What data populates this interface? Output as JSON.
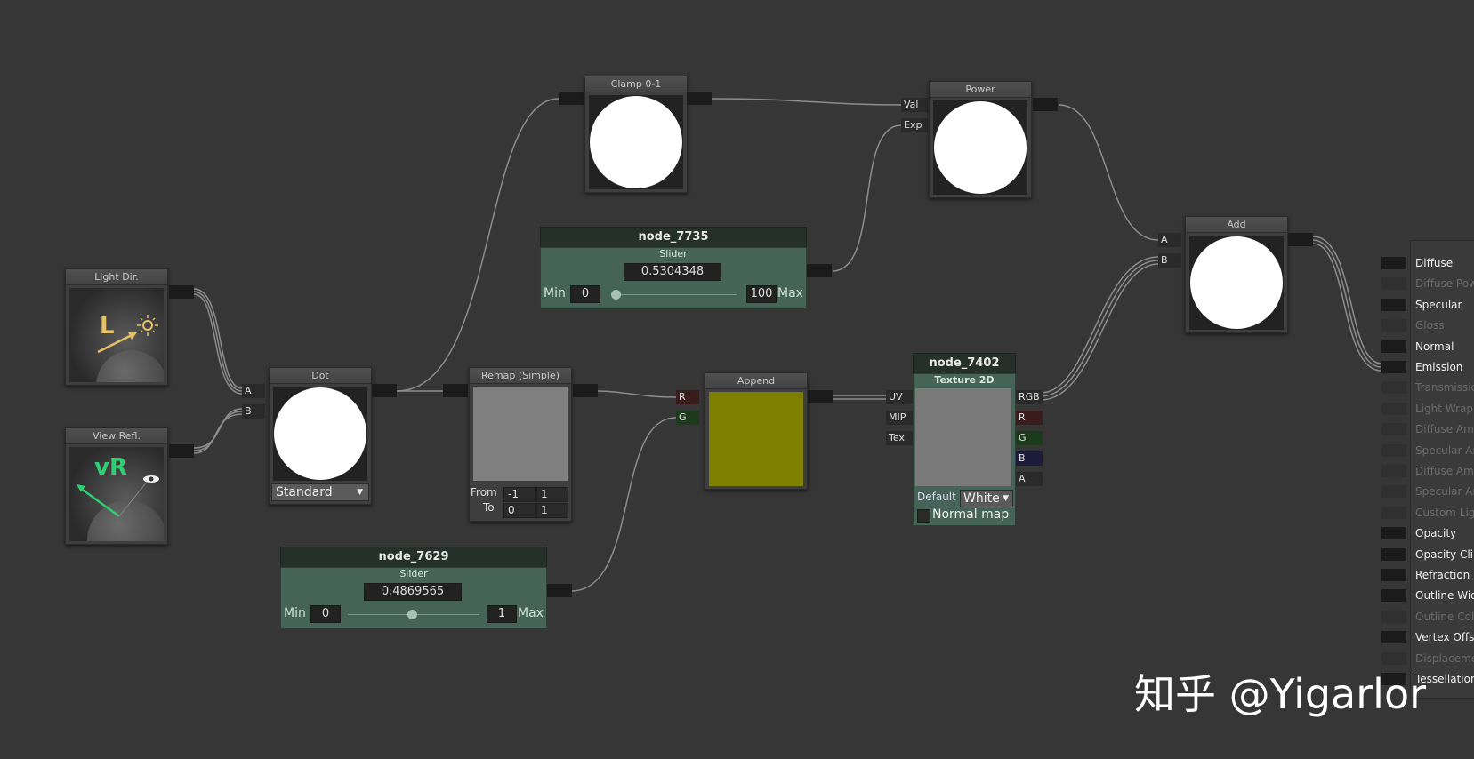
{
  "nodes": {
    "light_dir": {
      "title": "Light Dir.",
      "glyph": "L"
    },
    "view_refl": {
      "title": "View Refl.",
      "glyph": "vR"
    },
    "dot": {
      "title": "Dot",
      "in_a": "A",
      "in_b": "B",
      "mode": "Standard"
    },
    "clamp": {
      "title": "Clamp 0-1"
    },
    "power": {
      "title": "Power",
      "in_val": "Val",
      "in_exp": "Exp"
    },
    "add": {
      "title": "Add",
      "in_a": "A",
      "in_b": "B"
    },
    "slider_7735": {
      "name": "node_7735",
      "type": "Slider",
      "value": "0.5304348",
      "min_label": "Min",
      "min": "0",
      "max": "100",
      "max_label": "Max",
      "fraction": 0.0053
    },
    "slider_7629": {
      "name": "node_7629",
      "type": "Slider",
      "value": "0.4869565",
      "min_label": "Min",
      "min": "0",
      "max": "1",
      "max_label": "Max",
      "fraction": 0.4869565
    },
    "remap": {
      "title": "Remap (Simple)",
      "from_label": "From",
      "to_label": "To",
      "from_min": "-1",
      "from_max": "1",
      "to_min": "0",
      "to_max": "1"
    },
    "append": {
      "title": "Append",
      "in_r": "R",
      "in_g": "G",
      "preview_color": "#808000"
    },
    "texture": {
      "name": "node_7402",
      "type": "Texture 2D",
      "in_uv": "UV",
      "in_mip": "MIP",
      "in_tex": "Tex",
      "out_rgb": "RGB",
      "out_r": "R",
      "out_g": "G",
      "out_b": "B",
      "out_a": "A",
      "default_label": "Default",
      "default_value": "White",
      "normal_map_label": "Normal map"
    }
  },
  "inspector": {
    "items": [
      {
        "label": "Diffuse",
        "enabled": true
      },
      {
        "label": "Diffuse Powe",
        "enabled": false
      },
      {
        "label": "Specular",
        "enabled": true
      },
      {
        "label": "Gloss",
        "enabled": false
      },
      {
        "label": "Normal",
        "enabled": true
      },
      {
        "label": "Emission",
        "enabled": true
      },
      {
        "label": "Transmission",
        "enabled": false
      },
      {
        "label": "Light Wrapp",
        "enabled": false
      },
      {
        "label": "Diffuse Amb",
        "enabled": false
      },
      {
        "label": "Specular Am",
        "enabled": false
      },
      {
        "label": "Diffuse Amb",
        "enabled": false
      },
      {
        "label": "Specular Am",
        "enabled": false
      },
      {
        "label": "Custom Ligh",
        "enabled": false
      },
      {
        "label": "Opacity",
        "enabled": true
      },
      {
        "label": "Opacity Clip",
        "enabled": true
      },
      {
        "label": "Refraction",
        "enabled": true
      },
      {
        "label": "Outline Widt",
        "enabled": true
      },
      {
        "label": "Outline Colo",
        "enabled": false
      },
      {
        "label": "Vertex Offs",
        "enabled": true
      },
      {
        "label": "Displacemen",
        "enabled": false
      },
      {
        "label": "Tessellation",
        "enabled": true
      }
    ]
  },
  "watermark": "知乎 @Yigarlor",
  "colors": {
    "background": "#363636",
    "slider_body": "#456356",
    "append_preview": "#808000",
    "wire": "#8a8a8a"
  }
}
